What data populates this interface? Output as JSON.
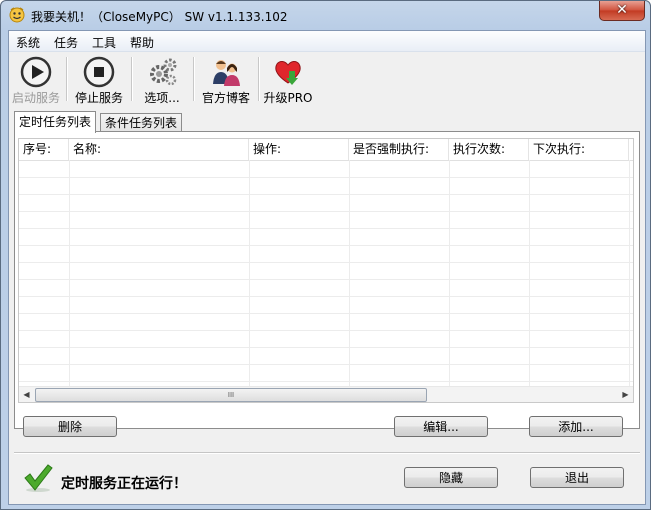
{
  "window": {
    "title": "我要关机！（CloseMyPC） SW v1.1.133.102",
    "close_label": "✕"
  },
  "menu": [
    "系统",
    "任务",
    "工具",
    "帮助"
  ],
  "toolbar": {
    "start": "启动服务",
    "stop": "停止服务",
    "options": "选项...",
    "blog": "官方博客",
    "upgrade": "升级PRO"
  },
  "tabs": [
    "定时任务列表",
    "条件任务列表"
  ],
  "grid": {
    "columns": [
      "序号:",
      "名称:",
      "操作:",
      "是否强制执行:",
      "执行次数:",
      "下次执行:"
    ],
    "scroll_grip": "III"
  },
  "buttons": {
    "delete": "删除",
    "edit": "编辑...",
    "add": "添加...",
    "hide": "隐藏",
    "exit": "退出"
  },
  "status": {
    "text": "定时服务正在运行！"
  },
  "colors": {
    "accent_check": "#4caa2c",
    "title_bar": "#b9cde6",
    "close_red": "#c23a22"
  }
}
